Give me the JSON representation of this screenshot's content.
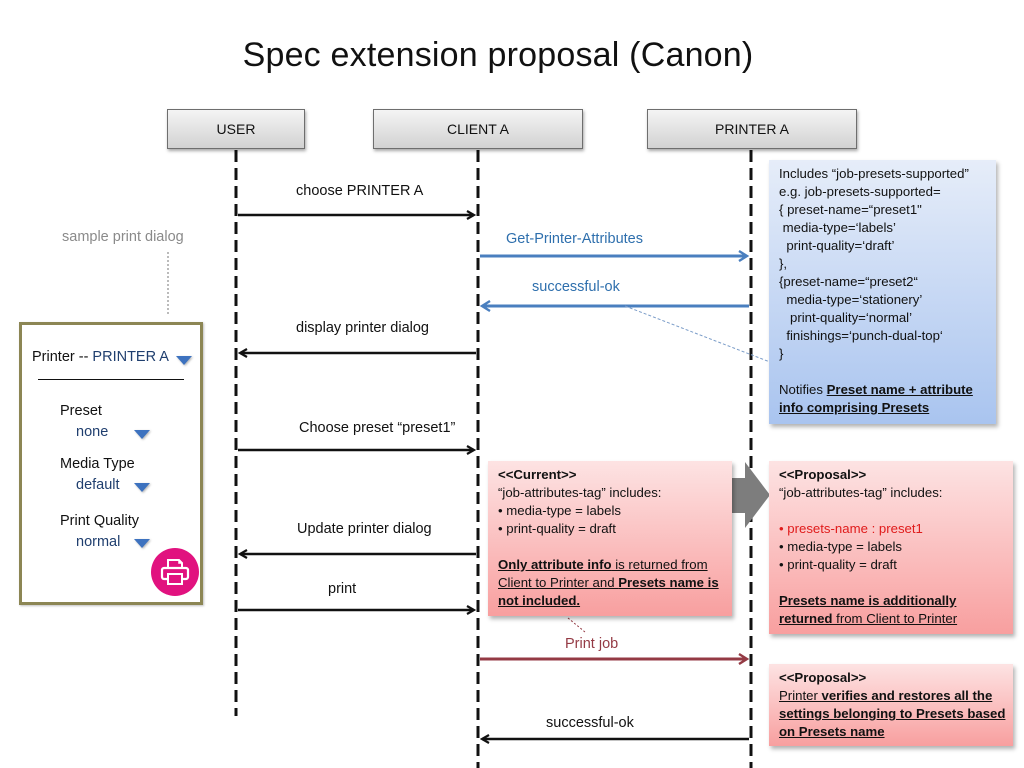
{
  "title": "Spec extension proposal (Canon)",
  "actors": [
    "USER",
    "CLIENT A",
    "PRINTER A"
  ],
  "messages": [
    {
      "label": "choose PRINTER A",
      "from": "USER",
      "to": "CLIENT A",
      "color": "#111111"
    },
    {
      "label": "Get-Printer-Attributes",
      "from": "CLIENT A",
      "to": "PRINTER A",
      "color": "#4a7fbf"
    },
    {
      "label": "successful-ok",
      "from": "PRINTER A",
      "to": "CLIENT A",
      "color": "#4a7fbf"
    },
    {
      "label": "display printer dialog",
      "from": "CLIENT A",
      "to": "USER",
      "color": "#111111"
    },
    {
      "label": "Choose preset  “preset1”",
      "from": "USER",
      "to": "CLIENT A",
      "color": "#111111"
    },
    {
      "label": "Update printer dialog",
      "from": "CLIENT A",
      "to": "USER",
      "color": "#111111"
    },
    {
      "label": "print",
      "from": "USER",
      "to": "CLIENT A",
      "color": "#111111"
    },
    {
      "label": "Print job",
      "from": "CLIENT A",
      "to": "PRINTER A",
      "color": "#943a44"
    },
    {
      "label": "successful-ok",
      "from": "PRINTER A",
      "to": "CLIENT A",
      "color": "#111111"
    }
  ],
  "sample_note": "sample print dialog",
  "dialog": {
    "printer_label": "Printer -- ",
    "printer_value": "PRINTER A",
    "fields": [
      {
        "label": "Preset",
        "value": "none"
      },
      {
        "label": "Media Type",
        "value": "default"
      },
      {
        "label": "Print Quality",
        "value": "normal"
      }
    ],
    "print_icon": "printer-icon",
    "accent_color": "#e1127f"
  },
  "printer_attributes_note": {
    "lines": [
      "Includes “job-presets-supported”",
      "e.g. job-presets-supported=",
      "{ preset-name=“preset1\"",
      " media-type=‘labels’",
      "  print-quality=‘draft’",
      "},",
      "{preset-name=“preset2“",
      "  media-type=‘stationery’",
      "   print-quality=‘normal’",
      "  finishings=‘punch-dual-top‘",
      "}",
      ""
    ],
    "notifies_prefix": "Notifies ",
    "notifies_bold_1": "Preset name + attribute",
    "notifies_bold_2": "info comprising Presets"
  },
  "current_note": {
    "heading": "<<Current>>",
    "intro": "“job-attributes-tag” includes:",
    "items": [
      "• media-type = labels",
      "• print-quality = draft"
    ],
    "summary_bold_1": "Only attribute info",
    "summary_text_1": " is returned from",
    "summary_text_2": "Client to Printer and ",
    "summary_bold_2": "Presets name is",
    "summary_bold_3": "not included."
  },
  "proposal_note_1": {
    "heading": "<<Proposal>>",
    "intro": "“job-attributes-tag” includes:",
    "highlight_item": "• presets-name : preset1",
    "items": [
      "• media-type = labels",
      "• print-quality = draft"
    ],
    "summary_bold_1": "Presets name is additionally",
    "summary_bold_2": "returned",
    "summary_text": " from Client to Printer",
    "highlight_color": "#e01b1b"
  },
  "proposal_note_2": {
    "heading": "<<Proposal>>",
    "line1_plain": "Printer ",
    "line1_bold": "verifies and restores all the",
    "line2_bold": "settings belonging to Presets based",
    "line3_bold": "on Presets name"
  },
  "colors": {
    "note_blue": "#a9c4ef",
    "note_pink": "#f89f9f",
    "arrow_blue": "#4a7fbf",
    "arrow_red": "#943a44",
    "dialog_border": "#8c8654"
  }
}
